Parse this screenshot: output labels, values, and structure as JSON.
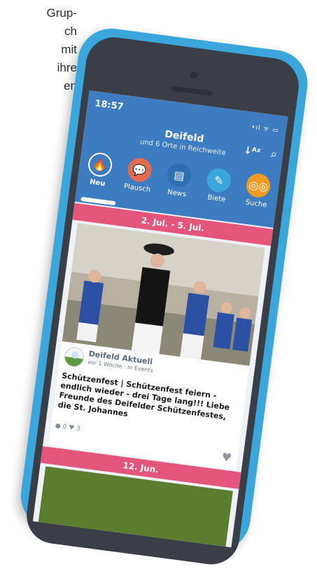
{
  "background_text": [
    "Grup-",
    "ch",
    "mit",
    "ihre",
    "en"
  ],
  "status_bar": {
    "time": "18:57",
    "indicators": "•ıl ᯤ ▭"
  },
  "header": {
    "title": "Deifeld",
    "subtitle": "und 6 Orte in Reichweite",
    "sort_icon": "sort-alpha-icon",
    "search_icon": "search-icon"
  },
  "tabs": [
    {
      "label": "Neu",
      "icon": "flame-icon",
      "color": "#3d7cc0",
      "active": true
    },
    {
      "label": "Plausch",
      "icon": "chat-bubble-icon",
      "color": "#e26a4f"
    },
    {
      "label": "News",
      "icon": "newspaper-icon",
      "color": "#3d7cc0"
    },
    {
      "label": "Biete",
      "icon": "tool-icon",
      "color": "#3aa6dc"
    },
    {
      "label": "Suche",
      "icon": "binoculars-icon",
      "color": "#f39a24"
    }
  ],
  "feed": [
    {
      "date_range": "2. Jul. - 5. Jul.",
      "source": "Deifeld Aktuell",
      "meta": "vor 1 Woche · in Events",
      "text": "Schützenfest | Schützenfest feiern - endlich wieder - drei Tage lang!!! Liebe Freunde des Deifelder Schützenfestes, die St. Johannes",
      "comments": "0",
      "likes": "3"
    },
    {
      "date_range": "12. Jun."
    }
  ],
  "colors": {
    "phone": "#3aa6dc",
    "header": "#3d7cc0",
    "date_bar": "#e4557c"
  }
}
